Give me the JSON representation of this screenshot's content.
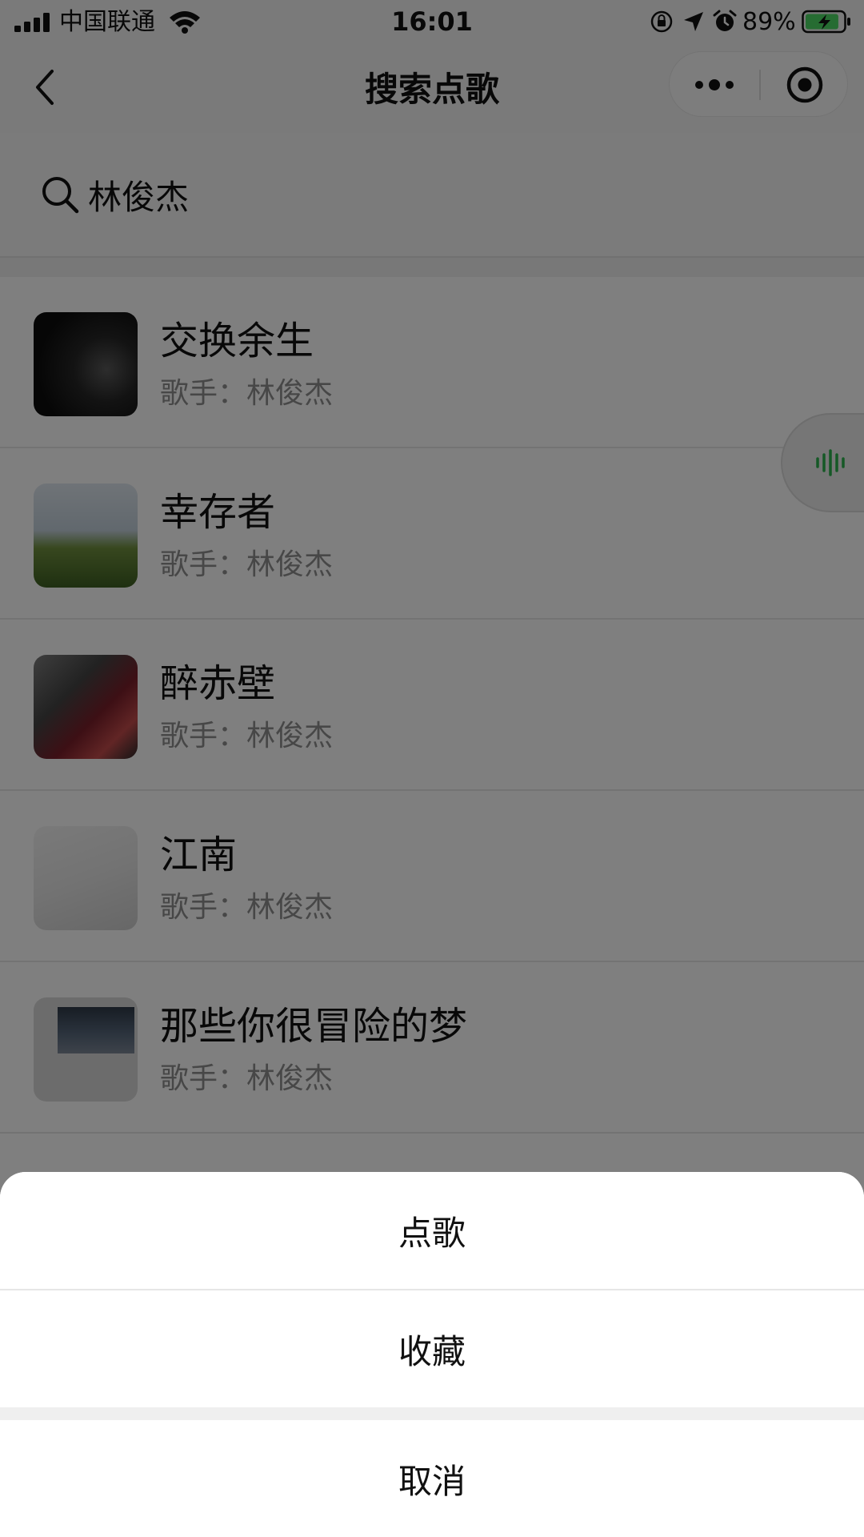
{
  "status_bar": {
    "carrier": "中国联通",
    "time": "16:01",
    "battery_percent": "89%",
    "battery_level": 0.89,
    "icons": [
      "signal-icon",
      "wifi-icon",
      "orientation-lock-icon",
      "location-icon",
      "alarm-icon",
      "battery-charging-icon"
    ]
  },
  "nav": {
    "title": "搜索点歌",
    "icons": [
      "back-icon",
      "more-icon",
      "close-miniprogram-icon"
    ]
  },
  "search": {
    "value": "林俊杰",
    "icon": "search-icon"
  },
  "songs": [
    {
      "title": "交换余生",
      "artist": "歌手：林俊杰"
    },
    {
      "title": "幸存者",
      "artist": "歌手：林俊杰"
    },
    {
      "title": "醉赤壁",
      "artist": "歌手：林俊杰"
    },
    {
      "title": "江南",
      "artist": "歌手：林俊杰"
    },
    {
      "title": "那些你很冒险的梦",
      "artist": "歌手：林俊杰"
    }
  ],
  "float_button": {
    "icon": "voice-wave-icon",
    "color": "#2bb24c"
  },
  "action_sheet": {
    "items": [
      "点歌",
      "收藏"
    ],
    "cancel": "取消"
  }
}
